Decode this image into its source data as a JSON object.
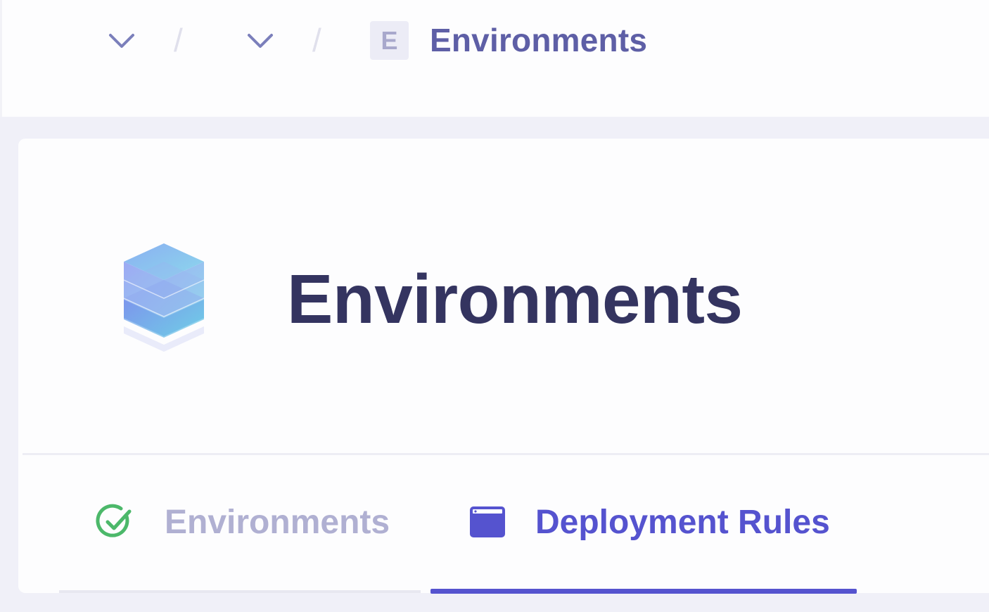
{
  "breadcrumb": {
    "separator": "/",
    "current": {
      "badge": "E",
      "label": "Environments"
    }
  },
  "header": {
    "title": "Environments",
    "logo_icon": "hexagon-stack-icon"
  },
  "tabs": [
    {
      "label": "Environments",
      "icon": "check-circle-icon",
      "active": false
    },
    {
      "label": "Deployment Rules",
      "icon": "browser-window-icon",
      "active": true
    }
  ],
  "colors": {
    "accent": "#5553cf",
    "title": "#343460",
    "breadcrumb_text": "#5e5fa6",
    "inactive_tab": "#b0b0d2",
    "success": "#4cb86a"
  }
}
